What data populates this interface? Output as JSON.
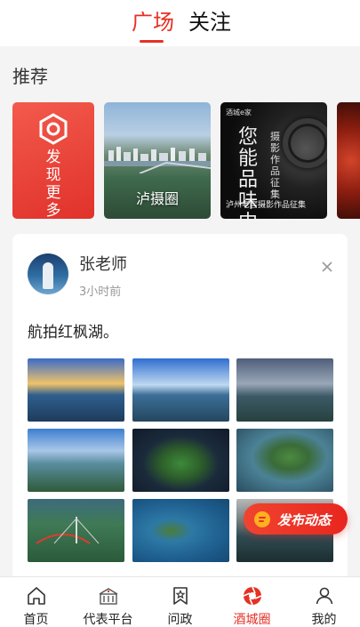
{
  "header": {
    "tabs": [
      {
        "label": "广场",
        "active": true
      },
      {
        "label": "关注",
        "active": false
      }
    ]
  },
  "recommend": {
    "title": "推荐",
    "cards": [
      {
        "type": "discover",
        "label": "发现更多",
        "chars": [
          "发",
          "现",
          "更",
          "多"
        ]
      },
      {
        "type": "image",
        "label": "泸摄圈"
      },
      {
        "type": "image",
        "logo_text": "酒城e家",
        "headline": "您能品味中历",
        "side_text": "摄影作品征集",
        "caption": "泸州老窖摄影作品征集"
      },
      {
        "type": "image",
        "label": ""
      }
    ]
  },
  "post": {
    "author": "张老师",
    "time": "3小时前",
    "text": "航拍红枫湖。",
    "photo_count": 9
  },
  "fab": {
    "label": "发布动态"
  },
  "bottom_nav": {
    "items": [
      {
        "label": "首页",
        "icon": "home-icon",
        "active": false
      },
      {
        "label": "代表平台",
        "icon": "building-icon",
        "active": false
      },
      {
        "label": "问政",
        "icon": "star-bookmark-icon",
        "active": false
      },
      {
        "label": "酒城圈",
        "icon": "aperture-icon",
        "active": true
      },
      {
        "label": "我的",
        "icon": "user-icon",
        "active": false
      }
    ]
  },
  "colors": {
    "accent": "#e53126",
    "background": "#f4f4f4"
  }
}
